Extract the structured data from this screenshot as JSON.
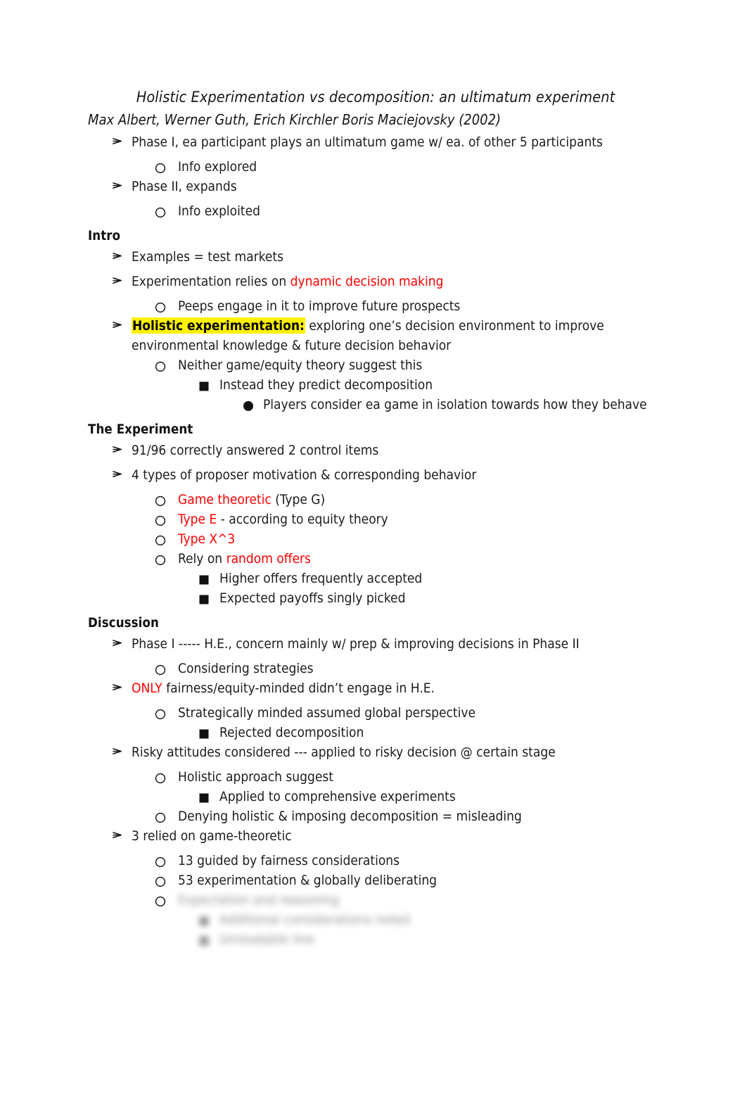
{
  "document": {
    "title": "Holistic Experimentation vs decomposition: an ultimatum experiment",
    "byline": "Max Albert, Werner Guth, Erich Kirchler Boris Maciejovsky (2002)",
    "bullet_glyphs": {
      "level1": "arrow-bullet",
      "level2": "hollow-circle-bullet",
      "level3": "filled-square-bullet",
      "level4": "filled-disc-bullet"
    },
    "colors": {
      "text": "#1c1c1c",
      "accent_red": "#ff0000",
      "highlight_yellow": "#fff200"
    }
  },
  "intro_items": [
    {
      "level": 1,
      "text": "Phase I, ea participant plays an ultimatum game w/ ea. of other 5 participants"
    },
    {
      "level": 2,
      "text": "Info explored"
    },
    {
      "level": 1,
      "text": "Phase II, expands"
    },
    {
      "level": 2,
      "text": "Info exploited"
    }
  ],
  "sections": [
    {
      "heading": "Intro",
      "items": [
        {
          "level": 1,
          "text": "Examples = test markets"
        },
        {
          "level": 1,
          "text_before": "Experimentation relies on ",
          "text_red": "dynamic decision making",
          "text_after": ""
        },
        {
          "level": 2,
          "text": "Peeps engage in it to improve future prospects"
        },
        {
          "level": 1,
          "text_highlight": "Holistic experimentation:",
          "text_after": " exploring one’s decision environment to improve environmental knowledge & future decision behavior"
        },
        {
          "level": 2,
          "text": "Neither game/equity theory suggest this"
        },
        {
          "level": 3,
          "text": "Instead they predict decomposition"
        },
        {
          "level": 4,
          "text": "Players consider ea game in isolation towards how they behave"
        }
      ]
    },
    {
      "heading": "The Experiment",
      "items": [
        {
          "level": 1,
          "text": "91/96 correctly answered 2 control items"
        },
        {
          "level": 1,
          "text": "4 types of proposer motivation & corresponding behavior"
        },
        {
          "level": 2,
          "text_red": "Game theoretic",
          "text_after": " (Type G)"
        },
        {
          "level": 2,
          "text_red": "Type E",
          "text_after": " - according to equity theory"
        },
        {
          "level": 2,
          "text_red": "Type X^3",
          "text_after": ""
        },
        {
          "level": 2,
          "text_before": "Rely on ",
          "text_red": "random offers",
          "text_after": ""
        },
        {
          "level": 3,
          "text": "Higher offers frequently accepted"
        },
        {
          "level": 3,
          "text": "Expected payoffs singly picked"
        }
      ]
    },
    {
      "heading": "Discussion",
      "items": [
        {
          "level": 1,
          "text": "Phase I ----- H.E., concern mainly w/ prep & improving decisions in Phase II"
        },
        {
          "level": 2,
          "text": "Considering strategies"
        },
        {
          "level": 1,
          "text_red": "ONLY",
          "text_after": " fairness/equity-minded didn’t engage in H.E."
        },
        {
          "level": 2,
          "text": "Strategically minded assumed global perspective"
        },
        {
          "level": 3,
          "text": "Rejected decomposition"
        },
        {
          "level": 1,
          "text": "Risky attitudes considered --- applied to risky decision @ certain stage"
        },
        {
          "level": 2,
          "text": "Holistic approach suggest"
        },
        {
          "level": 3,
          "text": "Applied to comprehensive experiments"
        },
        {
          "level": 2,
          "text": "Denying holistic & imposing decomposition = misleading"
        },
        {
          "level": 1,
          "text": "3 relied on game-theoretic"
        },
        {
          "level": 2,
          "text": "13 guided by fairness considerations"
        },
        {
          "level": 2,
          "text": "53 experimentation & globally deliberating"
        },
        {
          "level": 2,
          "blurred": true,
          "marker_sharp": true,
          "text": "Expectation and reasoning"
        },
        {
          "level": 3,
          "blurred": true,
          "text": "Additional considerations noted"
        },
        {
          "level": 3,
          "blurred": true,
          "text": "Unreadable line"
        }
      ]
    }
  ]
}
